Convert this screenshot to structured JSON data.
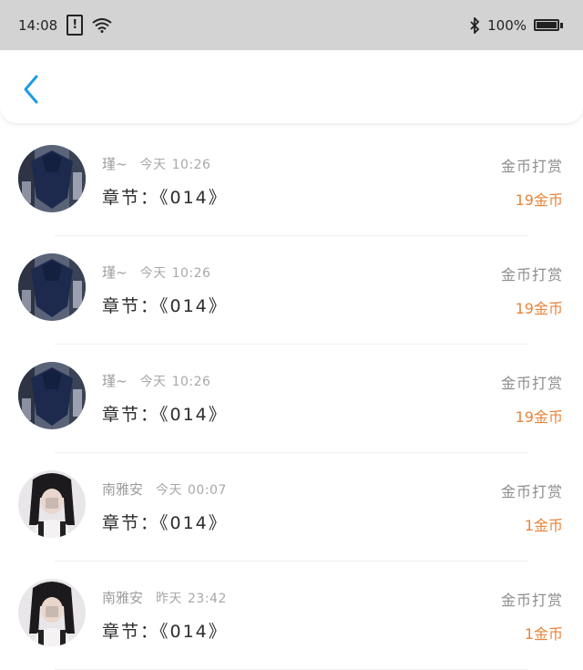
{
  "status_bar": {
    "time": "14:08",
    "battery": "100%",
    "icons": [
      "alert-icon",
      "wifi-icon",
      "bluetooth-icon",
      "battery-icon"
    ]
  },
  "nav": {
    "back_icon": "chevron-left-icon",
    "accent_color": "#1e9be6"
  },
  "list": {
    "items": [
      {
        "user": "瑾~",
        "date": "今天",
        "time": "10:26",
        "chapter": "章节：《014》",
        "reward_label": "金币打赏",
        "reward_amount": "19金币",
        "avatar": "dark"
      },
      {
        "user": "瑾~",
        "date": "今天",
        "time": "10:26",
        "chapter": "章节：《014》",
        "reward_label": "金币打赏",
        "reward_amount": "19金币",
        "avatar": "dark"
      },
      {
        "user": "瑾~",
        "date": "今天",
        "time": "10:26",
        "chapter": "章节：《014》",
        "reward_label": "金币打赏",
        "reward_amount": "19金币",
        "avatar": "dark"
      },
      {
        "user": "南雅安",
        "date": "今天",
        "time": "00:07",
        "chapter": "章节：《014》",
        "reward_label": "金币打赏",
        "reward_amount": "1金币",
        "avatar": "light"
      },
      {
        "user": "南雅安",
        "date": "昨天",
        "time": "23:42",
        "chapter": "章节：《014》",
        "reward_label": "金币打赏",
        "reward_amount": "1金币",
        "avatar": "light"
      }
    ]
  },
  "colors": {
    "reward_amount": "#e8843a",
    "status_bar_bg": "#d3d3d3"
  }
}
